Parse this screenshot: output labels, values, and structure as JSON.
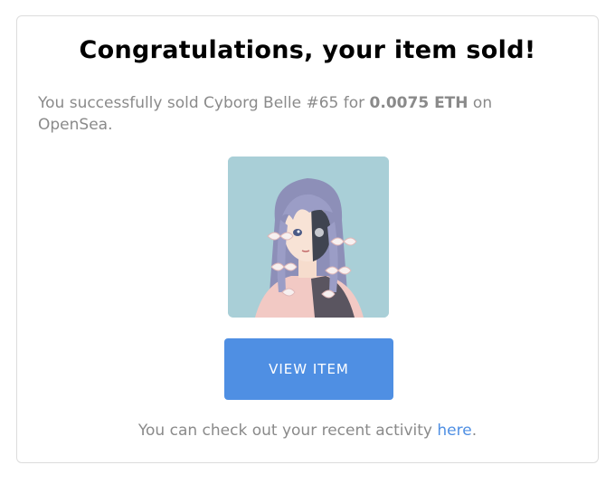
{
  "email": {
    "title": "Congratulations, your item sold!",
    "message": {
      "prefix": "You successfully sold Cyborg Belle #65 for ",
      "price": "0.0075 ETH",
      "suffix": " on OpenSea."
    },
    "item_image": {
      "icon": "cyborg-girl-nft-artwork",
      "background_color": "#a9cfd7"
    },
    "view_button_label": "VIEW ITEM",
    "footer": {
      "text": "You can check out your recent activity ",
      "link_label": "here",
      "end": "."
    }
  },
  "colors": {
    "accent": "#4f8fe3",
    "muted_text": "#8a8a8a"
  }
}
